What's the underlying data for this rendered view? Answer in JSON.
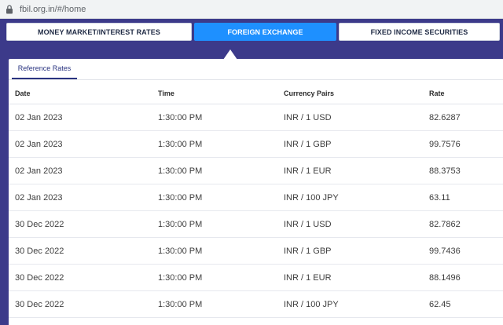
{
  "browser": {
    "url": "fbil.org.in/#/home"
  },
  "nav": {
    "money_market": "MONEY MARKET/INTEREST RATES",
    "foreign_exchange": "FOREIGN EXCHANGE",
    "fixed_income": "FIXED INCOME SECURITIES"
  },
  "tabs": {
    "reference_rates": "Reference Rates"
  },
  "table": {
    "headers": {
      "date": "Date",
      "time": "Time",
      "pair": "Currency Pairs",
      "rate": "Rate"
    },
    "rows": [
      {
        "date": "02 Jan 2023",
        "time": "1:30:00 PM",
        "pair": "INR / 1 USD",
        "rate": "82.6287"
      },
      {
        "date": "02 Jan 2023",
        "time": "1:30:00 PM",
        "pair": "INR / 1 GBP",
        "rate": "99.7576"
      },
      {
        "date": "02 Jan 2023",
        "time": "1:30:00 PM",
        "pair": "INR / 1 EUR",
        "rate": "88.3753"
      },
      {
        "date": "02 Jan 2023",
        "time": "1:30:00 PM",
        "pair": "INR / 100 JPY",
        "rate": "63.11"
      },
      {
        "date": "30 Dec 2022",
        "time": "1:30:00 PM",
        "pair": "INR / 1 USD",
        "rate": "82.7862"
      },
      {
        "date": "30 Dec 2022",
        "time": "1:30:00 PM",
        "pair": "INR / 1 GBP",
        "rate": "99.7436"
      },
      {
        "date": "30 Dec 2022",
        "time": "1:30:00 PM",
        "pair": "INR / 1 EUR",
        "rate": "88.1496"
      },
      {
        "date": "30 Dec 2022",
        "time": "1:30:00 PM",
        "pair": "INR / 100 JPY",
        "rate": "62.45"
      }
    ]
  },
  "colors": {
    "page_background": "#3c3a8a",
    "active_tab": "#1e90ff",
    "tab_underline": "#2a3480"
  }
}
